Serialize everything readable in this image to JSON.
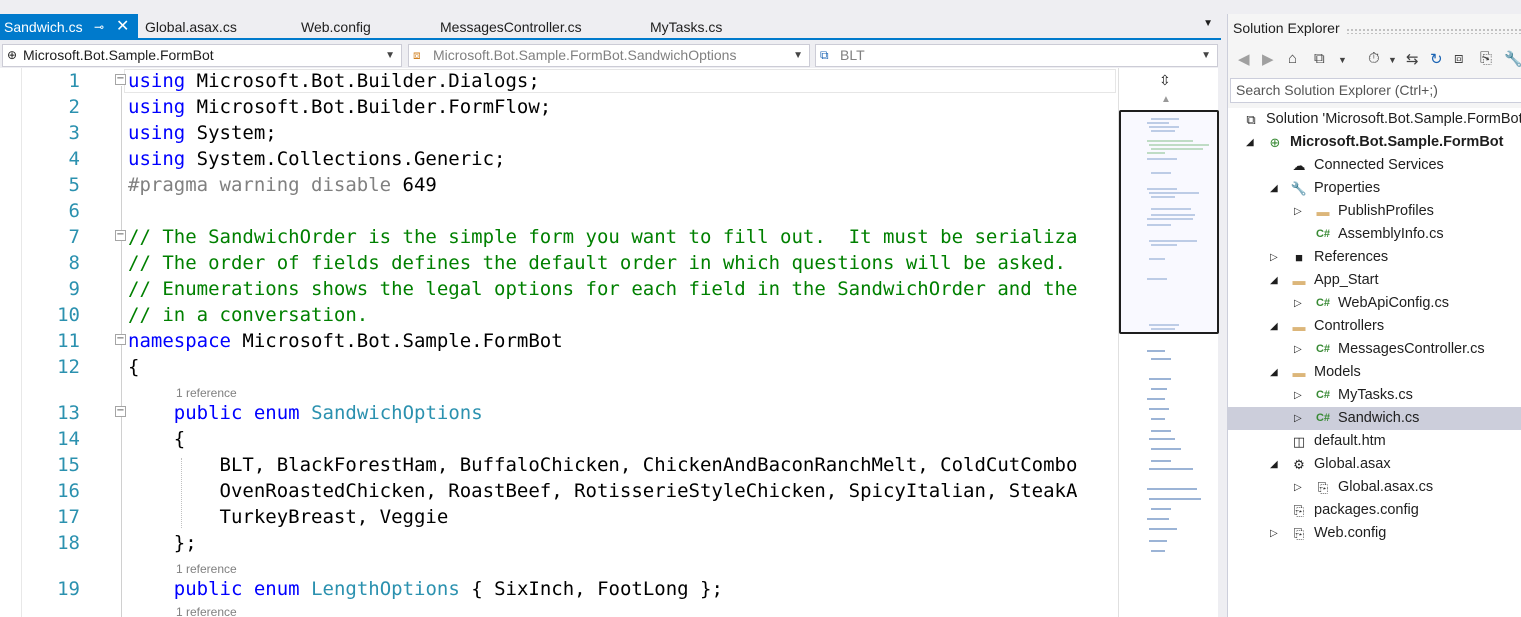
{
  "tabs": [
    {
      "label": "Sandwich.cs",
      "active": true
    },
    {
      "label": "Global.asax.cs",
      "active": false
    },
    {
      "label": "Web.config",
      "active": false
    },
    {
      "label": "MessagesController.cs",
      "active": false
    },
    {
      "label": "MyTasks.cs",
      "active": false
    }
  ],
  "tab_pin_glyph": "⊸",
  "tab_close_glyph": "✕",
  "tab_overflow_glyph": "▼",
  "navbar": {
    "project": "Microsoft.Bot.Sample.FormBot",
    "type": "Microsoft.Bot.Sample.FormBot.SandwichOptions",
    "member": "BLT"
  },
  "code_lines": [
    {
      "no": "1",
      "parts": [
        {
          "c": "kw",
          "t": "using"
        },
        {
          "c": "tx",
          "t": " Microsoft.Bot.Builder.Dialogs;"
        }
      ],
      "fold": "−"
    },
    {
      "no": "2",
      "parts": [
        {
          "c": "kw",
          "t": "using"
        },
        {
          "c": "tx",
          "t": " Microsoft.Bot.Builder.FormFlow;"
        }
      ]
    },
    {
      "no": "3",
      "parts": [
        {
          "c": "kw",
          "t": "using"
        },
        {
          "c": "tx",
          "t": " System;"
        }
      ]
    },
    {
      "no": "4",
      "parts": [
        {
          "c": "kw",
          "t": "using"
        },
        {
          "c": "tx",
          "t": " System.Collections.Generic;"
        }
      ]
    },
    {
      "no": "5",
      "parts": [
        {
          "c": "pp",
          "t": "#pragma warning disable"
        },
        {
          "c": "tx",
          "t": " 649"
        }
      ]
    },
    {
      "no": "6",
      "parts": []
    },
    {
      "no": "7",
      "parts": [
        {
          "c": "cm",
          "t": "// The SandwichOrder is the simple form you want to fill out.  It must be serializa"
        }
      ],
      "fold": "−"
    },
    {
      "no": "8",
      "parts": [
        {
          "c": "cm",
          "t": "// The order of fields defines the default order in which questions will be asked."
        }
      ]
    },
    {
      "no": "9",
      "parts": [
        {
          "c": "cm",
          "t": "// Enumerations shows the legal options for each field in the SandwichOrder and the"
        }
      ]
    },
    {
      "no": "10",
      "parts": [
        {
          "c": "cm",
          "t": "// in a conversation."
        }
      ]
    },
    {
      "no": "11",
      "parts": [
        {
          "c": "kw",
          "t": "namespace"
        },
        {
          "c": "tx",
          "t": " Microsoft.Bot.Sample.FormBot"
        }
      ],
      "fold": "−"
    },
    {
      "no": "12",
      "parts": [
        {
          "c": "tx",
          "t": "{"
        }
      ]
    },
    {
      "no": "13",
      "parts": [
        {
          "c": "tx",
          "t": "    "
        },
        {
          "c": "kw",
          "t": "public"
        },
        {
          "c": "tx",
          "t": " "
        },
        {
          "c": "kw",
          "t": "enum"
        },
        {
          "c": "tx",
          "t": " "
        },
        {
          "c": "ty",
          "t": "SandwichOptions"
        }
      ],
      "fold": "−",
      "lens": "1 reference"
    },
    {
      "no": "14",
      "parts": [
        {
          "c": "tx",
          "t": "    {"
        }
      ]
    },
    {
      "no": "15",
      "parts": [
        {
          "c": "tx",
          "t": "        BLT, BlackForestHam, BuffaloChicken, ChickenAndBaconRanchMelt, ColdCutCombo"
        }
      ]
    },
    {
      "no": "16",
      "parts": [
        {
          "c": "tx",
          "t": "        OvenRoastedChicken, RoastBeef, RotisserieStyleChicken, SpicyItalian, SteakA"
        }
      ]
    },
    {
      "no": "17",
      "parts": [
        {
          "c": "tx",
          "t": "        TurkeyBreast, Veggie"
        }
      ]
    },
    {
      "no": "18",
      "parts": [
        {
          "c": "tx",
          "t": "    };"
        }
      ]
    },
    {
      "no": "19",
      "parts": [
        {
          "c": "tx",
          "t": "    "
        },
        {
          "c": "kw",
          "t": "public"
        },
        {
          "c": "tx",
          "t": " "
        },
        {
          "c": "kw",
          "t": "enum"
        },
        {
          "c": "tx",
          "t": " "
        },
        {
          "c": "ty",
          "t": "LengthOptions"
        },
        {
          "c": "tx",
          "t": " { SixInch, FootLong };"
        }
      ],
      "lens": "1 reference"
    }
  ],
  "trailing_lens": "1 reference",
  "solution_explorer": {
    "title": "Solution Explorer",
    "search_placeholder": "Search Solution Explorer (Ctrl+;)",
    "items": [
      {
        "label": "Solution 'Microsoft.Bot.Sample.FormBot",
        "icon": "solution-icon",
        "glyph": "⧉",
        "level": 0,
        "exp": ""
      },
      {
        "label": "Microsoft.Bot.Sample.FormBot",
        "icon": "web-project-icon",
        "glyph": "⊕",
        "level": 1,
        "exp": "◢",
        "bold": true
      },
      {
        "label": "Connected Services",
        "icon": "connected-services-icon",
        "glyph": "☁",
        "level": 2,
        "exp": ""
      },
      {
        "label": "Properties",
        "icon": "wrench-icon",
        "glyph": "🔧",
        "level": 2,
        "exp": "◢"
      },
      {
        "label": "PublishProfiles",
        "icon": "folder-icon",
        "glyph": "▬",
        "level": 3,
        "exp": "▷"
      },
      {
        "label": "AssemblyInfo.cs",
        "icon": "csharp-file-icon",
        "glyph": "C#",
        "level": 3,
        "exp": ""
      },
      {
        "label": "References",
        "icon": "references-icon",
        "glyph": "■",
        "level": 2,
        "exp": "▷"
      },
      {
        "label": "App_Start",
        "icon": "folder-icon",
        "glyph": "▬",
        "level": 2,
        "exp": "◢"
      },
      {
        "label": "WebApiConfig.cs",
        "icon": "csharp-file-icon",
        "glyph": "C#",
        "level": 3,
        "exp": "▷"
      },
      {
        "label": "Controllers",
        "icon": "folder-icon",
        "glyph": "▬",
        "level": 2,
        "exp": "◢"
      },
      {
        "label": "MessagesController.cs",
        "icon": "csharp-file-icon",
        "glyph": "C#",
        "level": 3,
        "exp": "▷"
      },
      {
        "label": "Models",
        "icon": "folder-icon",
        "glyph": "▬",
        "level": 2,
        "exp": "◢"
      },
      {
        "label": "MyTasks.cs",
        "icon": "csharp-file-icon",
        "glyph": "C#",
        "level": 3,
        "exp": "▷"
      },
      {
        "label": "Sandwich.cs",
        "icon": "csharp-file-icon",
        "glyph": "C#",
        "level": 3,
        "exp": "▷",
        "selected": true
      },
      {
        "label": "default.htm",
        "icon": "html-file-icon",
        "glyph": "◫",
        "level": 2,
        "exp": ""
      },
      {
        "label": "Global.asax",
        "icon": "asax-file-icon",
        "glyph": "⚙",
        "level": 2,
        "exp": "◢"
      },
      {
        "label": "Global.asax.cs",
        "icon": "csharp-file-icon",
        "glyph": "⎘",
        "level": 3,
        "exp": "▷"
      },
      {
        "label": "packages.config",
        "icon": "config-file-icon",
        "glyph": "⎘",
        "level": 2,
        "exp": ""
      },
      {
        "label": "Web.config",
        "icon": "config-file-icon",
        "glyph": "⎘",
        "level": 2,
        "exp": "▷"
      }
    ]
  },
  "colors": {
    "accent": "#007acc",
    "keyword": "#0000ff",
    "type": "#2b91af",
    "comment": "#008000",
    "line_number": "#2b91af",
    "selection": "#cccedb"
  }
}
